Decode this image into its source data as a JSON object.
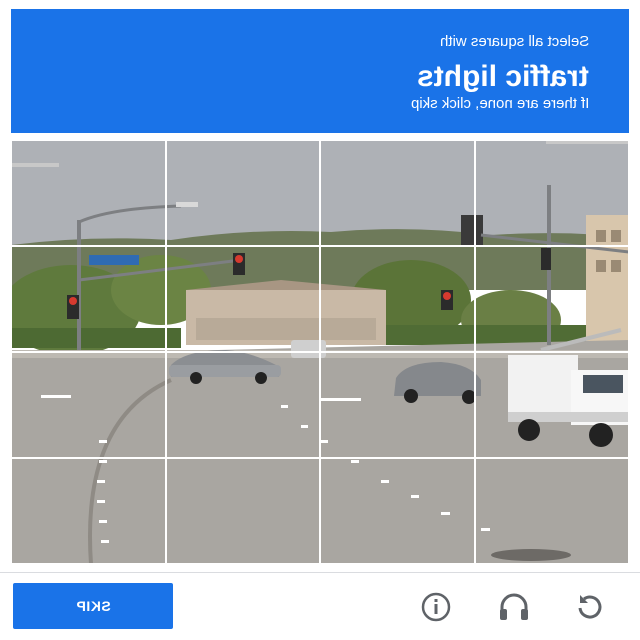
{
  "header": {
    "instruction_line1": "Select all squares with",
    "target_label": "traffic lights",
    "instruction_line3": "If there are none, click skip",
    "background_color": "#1a73e8"
  },
  "grid": {
    "rows": 4,
    "columns": 4,
    "tiles": [
      "tile-1",
      "tile-2",
      "tile-3",
      "tile-4",
      "tile-5",
      "tile-6",
      "tile-7",
      "tile-8",
      "tile-9",
      "tile-10",
      "tile-11",
      "tile-12",
      "tile-13",
      "tile-14",
      "tile-15",
      "tile-16"
    ]
  },
  "footer": {
    "skip_label": "SKIP",
    "icons": [
      "info-icon",
      "headphones-icon",
      "reload-icon"
    ],
    "button_color": "#1a73e8"
  }
}
